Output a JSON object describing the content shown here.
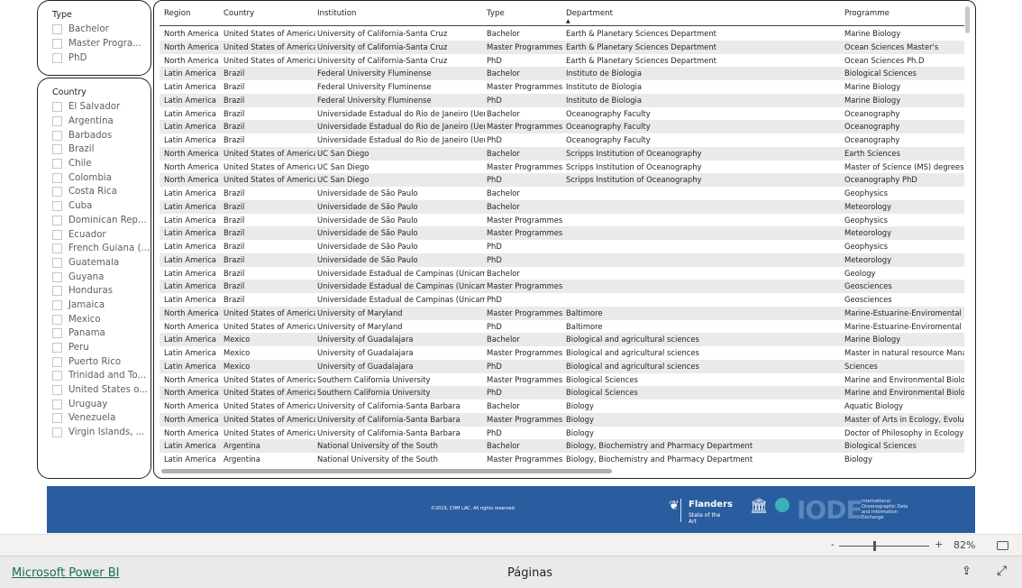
{
  "filters": {
    "type": {
      "title": "Type",
      "items": [
        "Bachelor",
        "Master Progra...",
        "PhD"
      ]
    },
    "country": {
      "title": "Country",
      "items": [
        "El Salvador",
        "Argentina",
        "Barbados",
        "Brazil",
        "Chile",
        "Colombia",
        "Costa Rica",
        "Cuba",
        "Dominican Rep...",
        "Ecuador",
        "French Guiana (...",
        "Guatemala",
        "Guyana",
        "Honduras",
        "Jamaica",
        "Mexico",
        "Panama",
        "Peru",
        "Puerto Rico",
        "Trinidad and To...",
        "United States o...",
        "Uruguay",
        "Venezuela",
        "Virgin Islands, ..."
      ]
    }
  },
  "table": {
    "columns": [
      "Region",
      "Country",
      "Institution",
      "Type",
      "Department",
      "Programme"
    ],
    "sort_column": "Department",
    "rows": [
      [
        "North America",
        "United States of America",
        "University of California-Santa Cruz",
        "Bachelor",
        "Earth & Planetary Sciences Department",
        "Marine Biology"
      ],
      [
        "North America",
        "United States of America",
        "University of California-Santa Cruz",
        "Master Programmes",
        "Earth & Planetary Sciences Department",
        "Ocean Sciences Master's"
      ],
      [
        "North America",
        "United States of America",
        "University of California-Santa Cruz",
        "PhD",
        "Earth & Planetary Sciences Department",
        "Ocean Sciences Ph.D"
      ],
      [
        "Latin America",
        "Brazil",
        "Federal University Fluminense",
        "Bachelor",
        "Instituto de Biologia",
        "Biological Sciences"
      ],
      [
        "Latin America",
        "Brazil",
        "Federal University Fluminense",
        "Master Programmes",
        "Instituto de Biologia",
        "Marine Biology"
      ],
      [
        "Latin America",
        "Brazil",
        "Federal University Fluminense",
        "PhD",
        "Instituto de Biologia",
        "Marine Biology"
      ],
      [
        "Latin America",
        "Brazil",
        "Universidade Estadual do Rio de Janeiro (Uerj)",
        "Bachelor",
        "Oceanography Faculty",
        "Oceanography"
      ],
      [
        "Latin America",
        "Brazil",
        "Universidade Estadual do Rio de Janeiro (Uerj)",
        "Master Programmes",
        "Oceanography Faculty",
        "Oceanography"
      ],
      [
        "Latin America",
        "Brazil",
        "Universidade Estadual do Rio de Janeiro (Uerj)",
        "PhD",
        "Oceanography Faculty",
        "Oceanography"
      ],
      [
        "North America",
        "United States of America",
        "UC San Diego",
        "Bachelor",
        "Scripps Institution of Oceanography",
        "Earth Sciences"
      ],
      [
        "North America",
        "United States of America",
        "UC San Diego",
        "Master Programmes",
        "Scripps Institution of Oceanography",
        "Master of Science (MS) degrees in"
      ],
      [
        "North America",
        "United States of America",
        "UC San Diego",
        "PhD",
        "Scripps Institution of Oceanography",
        "Oceanography PhD"
      ],
      [
        "Latin America",
        "Brazil",
        "Universidade de São Paulo",
        "Bachelor",
        "",
        "Geophysics"
      ],
      [
        "Latin America",
        "Brazil",
        "Universidade de São Paulo",
        "Bachelor",
        "",
        "Meteorology"
      ],
      [
        "Latin America",
        "Brazil",
        "Universidade de São Paulo",
        "Master Programmes",
        "",
        "Geophysics"
      ],
      [
        "Latin America",
        "Brazil",
        "Universidade de São Paulo",
        "Master Programmes",
        "",
        "Meteorology"
      ],
      [
        "Latin America",
        "Brazil",
        "Universidade de São Paulo",
        "PhD",
        "",
        "Geophysics"
      ],
      [
        "Latin America",
        "Brazil",
        "Universidade de São Paulo",
        "PhD",
        "",
        "Meteorology"
      ],
      [
        "Latin America",
        "Brazil",
        "Universidade Estadual de Campinas (Unicamp)",
        "Bachelor",
        "",
        "Geology"
      ],
      [
        "Latin America",
        "Brazil",
        "Universidade Estadual de Campinas (Unicamp)",
        "Master Programmes",
        "",
        "Geosciences"
      ],
      [
        "Latin America",
        "Brazil",
        "Universidade Estadual de Campinas (Unicamp)",
        "PhD",
        "",
        "Geosciences"
      ],
      [
        "North America",
        "United States of America",
        "University of Maryland",
        "Master Programmes",
        "Baltimore",
        "Marine-Estuarine-Enviromental Sci"
      ],
      [
        "North America",
        "United States of America",
        "University of Maryland",
        "PhD",
        "Baltimore",
        "Marine-Estuarine-Enviromental Sci"
      ],
      [
        "Latin America",
        "Mexico",
        "University of Guadalajara",
        "Bachelor",
        "Biological and agricultural sciences",
        "Marine Biology"
      ],
      [
        "Latin America",
        "Mexico",
        "University of Guadalajara",
        "Master Programmes",
        "Biological and agricultural sciences",
        "Master in natural resource Manage"
      ],
      [
        "Latin America",
        "Mexico",
        "University of Guadalajara",
        "PhD",
        "Biological and agricultural sciences",
        "Sciences"
      ],
      [
        "North America",
        "United States of America",
        "Southern California University",
        "Master Programmes",
        "Biological Sciences",
        "Marine and Environmental Biology"
      ],
      [
        "North America",
        "United States of America",
        "Southern California University",
        "PhD",
        "Biological Sciences",
        "Marine and Environmental Biology"
      ],
      [
        "North America",
        "United States of America",
        "University of California-Santa Barbara",
        "Bachelor",
        "Biology",
        "Aquatic Biology"
      ],
      [
        "North America",
        "United States of America",
        "University of California-Santa Barbara",
        "Master Programmes",
        "Biology",
        "Master of Arts in Ecology, Evolution"
      ],
      [
        "North America",
        "United States of America",
        "University of California-Santa Barbara",
        "PhD",
        "Biology",
        "Doctor of Philosophy in Ecology, E"
      ],
      [
        "Latin America",
        "Argentina",
        "National University of the South",
        "Bachelor",
        "Biology, Biochemistry and Pharmacy Department",
        "Biological Sciences"
      ],
      [
        "Latin America",
        "Argentina",
        "National University of the South",
        "Master Programmes",
        "Biology, Biochemistry and Pharmacy Department",
        "Biology"
      ]
    ]
  },
  "banner": {
    "copyright": "©2019, CHM LAC. All rights reserved.",
    "logo1_title": "Flanders",
    "logo1_sub": "State of the Art",
    "logo2": "IODE",
    "logo2_text": "International Oceanographic Data and Information Exchange",
    "color": "#2a5d9f"
  },
  "zoom": {
    "minus": "-",
    "plus": "+",
    "level": "82%",
    "value_percent": 82
  },
  "bottom": {
    "brand_link": "Microsoft Power BI",
    "pages_label": "Páginas"
  }
}
